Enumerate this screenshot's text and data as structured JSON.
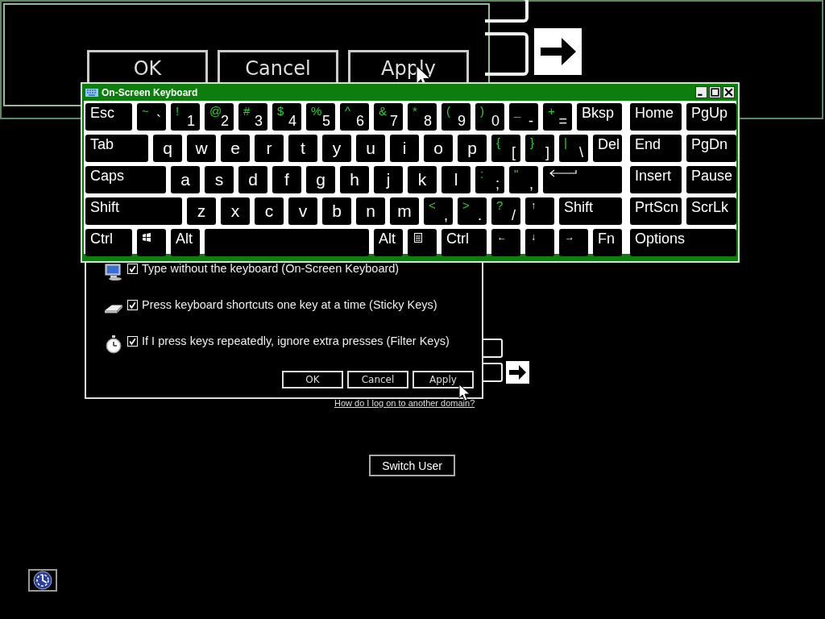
{
  "magnified_view": {
    "buttons": [
      "OK",
      "Cancel",
      "Apply"
    ]
  },
  "on_screen_keyboard": {
    "title": "On-Screen Keyboard",
    "rows": [
      {
        "keys": [
          {
            "kind": "label",
            "label": "Esc"
          },
          {
            "kind": "dual",
            "shift": "~",
            "base": "`"
          },
          {
            "kind": "dual",
            "shift": "!",
            "base": "1"
          },
          {
            "kind": "dual",
            "shift": "@",
            "base": "2"
          },
          {
            "kind": "dual",
            "shift": "#",
            "base": "3"
          },
          {
            "kind": "dual",
            "shift": "$",
            "base": "4"
          },
          {
            "kind": "dual",
            "shift": "%",
            "base": "5"
          },
          {
            "kind": "dual",
            "shift": "^",
            "base": "6"
          },
          {
            "kind": "dual",
            "shift": "&",
            "base": "7"
          },
          {
            "kind": "dual",
            "shift": "*",
            "base": "8"
          },
          {
            "kind": "dual",
            "shift": "(",
            "base": "9"
          },
          {
            "kind": "dual",
            "shift": ")",
            "base": "0"
          },
          {
            "kind": "dual",
            "shift": "_",
            "base": "-"
          },
          {
            "kind": "dual",
            "shift": "+",
            "base": "="
          },
          {
            "kind": "label",
            "label": "Bksp"
          }
        ],
        "nav": [
          {
            "kind": "label",
            "label": "Home"
          },
          {
            "kind": "label",
            "label": "PgUp"
          }
        ]
      },
      {
        "keys": [
          {
            "kind": "label",
            "label": "Tab"
          },
          {
            "kind": "letter",
            "label": "q"
          },
          {
            "kind": "letter",
            "label": "w"
          },
          {
            "kind": "letter",
            "label": "e"
          },
          {
            "kind": "letter",
            "label": "r"
          },
          {
            "kind": "letter",
            "label": "t"
          },
          {
            "kind": "letter",
            "label": "y"
          },
          {
            "kind": "letter",
            "label": "u"
          },
          {
            "kind": "letter",
            "label": "i"
          },
          {
            "kind": "letter",
            "label": "o"
          },
          {
            "kind": "letter",
            "label": "p"
          },
          {
            "kind": "dual",
            "shift": "{",
            "base": "["
          },
          {
            "kind": "dual",
            "shift": "}",
            "base": "]"
          },
          {
            "kind": "dual",
            "shift": "|",
            "base": "\\"
          },
          {
            "kind": "label",
            "label": "Del"
          }
        ],
        "nav": [
          {
            "kind": "label",
            "label": "End"
          },
          {
            "kind": "label",
            "label": "PgDn"
          }
        ]
      },
      {
        "keys": [
          {
            "kind": "label",
            "label": "Caps"
          },
          {
            "kind": "letter",
            "label": "a"
          },
          {
            "kind": "letter",
            "label": "s"
          },
          {
            "kind": "letter",
            "label": "d"
          },
          {
            "kind": "letter",
            "label": "f"
          },
          {
            "kind": "letter",
            "label": "g"
          },
          {
            "kind": "letter",
            "label": "h"
          },
          {
            "kind": "letter",
            "label": "j"
          },
          {
            "kind": "letter",
            "label": "k"
          },
          {
            "kind": "letter",
            "label": "l"
          },
          {
            "kind": "dual",
            "shift": ":",
            "base": ";"
          },
          {
            "kind": "dual",
            "shift": "\"",
            "base": ","
          },
          {
            "kind": "enter"
          }
        ],
        "nav": [
          {
            "kind": "label",
            "label": "Insert"
          },
          {
            "kind": "label",
            "label": "Pause"
          }
        ]
      },
      {
        "keys": [
          {
            "kind": "label",
            "label": "Shift"
          },
          {
            "kind": "letter",
            "label": "z"
          },
          {
            "kind": "letter",
            "label": "x"
          },
          {
            "kind": "letter",
            "label": "c"
          },
          {
            "kind": "letter",
            "label": "v"
          },
          {
            "kind": "letter",
            "label": "b"
          },
          {
            "kind": "letter",
            "label": "n"
          },
          {
            "kind": "letter",
            "label": "m"
          },
          {
            "kind": "dual",
            "shift": "<",
            "base": ","
          },
          {
            "kind": "dual",
            "shift": ">",
            "base": "."
          },
          {
            "kind": "dual",
            "shift": "?",
            "base": "/"
          },
          {
            "kind": "arrow",
            "label": "↑"
          },
          {
            "kind": "label",
            "label": "Shift"
          }
        ],
        "nav": [
          {
            "kind": "label",
            "label": "PrtScn"
          },
          {
            "kind": "label",
            "label": "ScrLk"
          }
        ]
      },
      {
        "keys": [
          {
            "kind": "label",
            "label": "Ctrl"
          },
          {
            "kind": "windows"
          },
          {
            "kind": "label",
            "label": "Alt"
          },
          {
            "kind": "space"
          },
          {
            "kind": "label",
            "label": "Alt"
          },
          {
            "kind": "menu"
          },
          {
            "kind": "label",
            "label": "Ctrl"
          },
          {
            "kind": "arrow",
            "label": "←"
          },
          {
            "kind": "arrow",
            "label": "↓"
          },
          {
            "kind": "arrow",
            "label": "→"
          },
          {
            "kind": "label",
            "label": "Fn"
          }
        ],
        "nav": [
          {
            "kind": "label",
            "label": "Options"
          }
        ]
      }
    ]
  },
  "ease_of_access_dialog": {
    "options": [
      {
        "kind": "monitor",
        "label": "Type without the keyboard (On-Screen Keyboard)",
        "checked": true
      },
      {
        "kind": "keyboard",
        "label": "Press keyboard shortcuts one key at a time (Sticky Keys)",
        "checked": true
      },
      {
        "kind": "stopwatch",
        "label": "If I press keys repeatedly, ignore extra presses (Filter Keys)",
        "checked": true
      }
    ],
    "buttons": [
      "OK",
      "Cancel",
      "Apply"
    ]
  },
  "link": "How do I log on to another domain?",
  "switch_user_button": "Switch User"
}
